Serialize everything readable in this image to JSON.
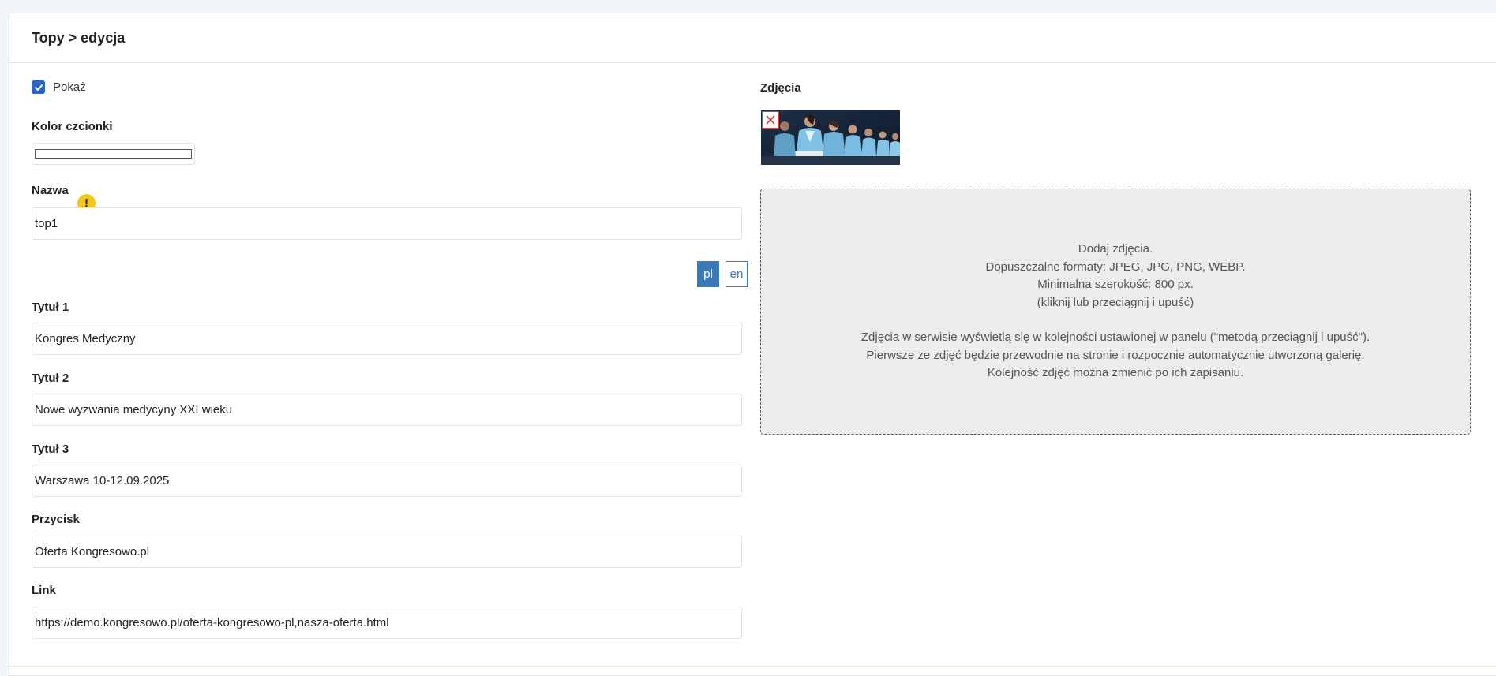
{
  "header": {
    "breadcrumb": "Topy > edycja"
  },
  "form": {
    "show_label": "Pokaż",
    "show_checked": true,
    "font_color_label": "Kolor czcionki",
    "font_color_value": "#ffffff",
    "name_label": "Nazwa",
    "name_value": "top1",
    "lang_pl": "pl",
    "lang_en": "en",
    "title1_label": "Tytuł 1",
    "title1_value": "Kongres Medyczny",
    "title2_label": "Tytuł 2",
    "title2_value": "Nowe wyzwania medycyny XXI wieku",
    "title3_label": "Tytuł 3",
    "title3_value": "Warszawa 10-12.09.2025",
    "button_label": "Przycisk",
    "button_value": "Oferta Kongresowo.pl",
    "link_label": "Link",
    "link_value": "https://demo.kongresowo.pl/oferta-kongresowo-pl,nasza-oferta.html"
  },
  "photos": {
    "label": "Zdjęcia",
    "dropzone_line1": "Dodaj zdjęcia.",
    "dropzone_line2": "Dopuszczalne formaty: JPEG, JPG, PNG, WEBP.",
    "dropzone_line3": "Minimalna szerokość: 800 px.",
    "dropzone_line4": "(kliknij lub przeciągnij i upuść)",
    "dropzone_line5": "Zdjęcia w serwisie wyświetlą się w kolejności ustawionej w panelu (\"metodą przeciągnij i upuść\").",
    "dropzone_line6": "Pierwsze ze zdjęć będzie przewodnie na stronie i rozpocznie automatycznie utworzoną galerię.",
    "dropzone_line7": "Kolejność zdjęć można zmienić po ich zapisaniu."
  },
  "colors": {
    "accent": "#2b65c7",
    "lang_active": "#3a78b8",
    "warning": "#f5c518",
    "delete": "#dd3333"
  },
  "icons": {
    "checkbox": "check-icon",
    "warning": "exclamation-icon",
    "delete": "close-icon"
  }
}
